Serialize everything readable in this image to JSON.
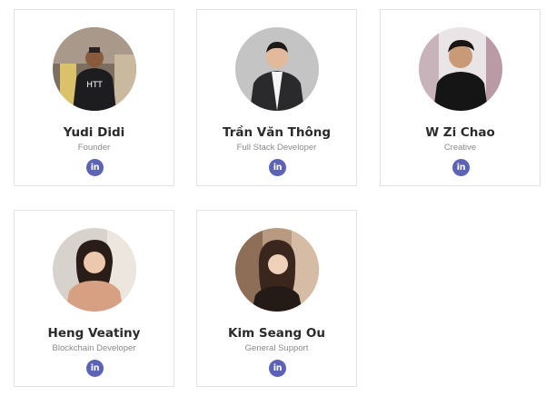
{
  "members": [
    {
      "name": "Yudi Didi",
      "role": "Founder",
      "social_icon": "linkedin-icon",
      "social_text": "in"
    },
    {
      "name": "Trần Văn Thông",
      "role": "Full Stack Developer",
      "social_icon": "linkedin-icon",
      "social_text": "in"
    },
    {
      "name": "W Zi Chao",
      "role": "Creative",
      "social_icon": "linkedin-icon",
      "social_text": "in"
    },
    {
      "name": "Heng Veatiny",
      "role": "Blockchain Developer",
      "social_icon": "linkedin-icon",
      "social_text": "in"
    },
    {
      "name": "Kim Seang Ou",
      "role": "General Support",
      "social_icon": "linkedin-icon",
      "social_text": "in"
    }
  ],
  "colors": {
    "linkedin_badge": "#5c63b5",
    "name_text": "#2b2b2b",
    "role_text": "#8a8a8a",
    "card_border": "#e3e3e3"
  }
}
